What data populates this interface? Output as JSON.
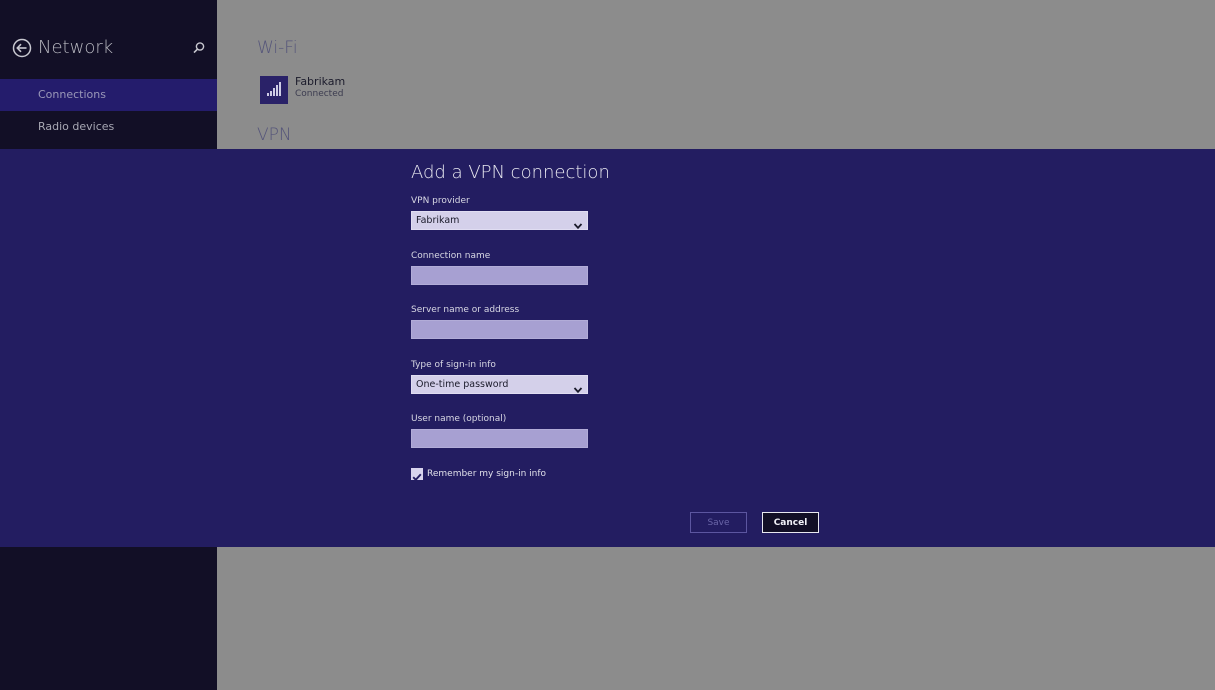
{
  "sidebar": {
    "title": "Network",
    "items": [
      {
        "label": "Connections",
        "active": true
      },
      {
        "label": "Radio devices",
        "active": false
      }
    ]
  },
  "main": {
    "wifi_heading": "Wi-Fi",
    "network": {
      "name": "Fabrikam",
      "status": "Connected"
    },
    "vpn_heading": "VPN"
  },
  "dialog": {
    "title": "Add a VPN connection",
    "fields": {
      "vpn_provider": {
        "label": "VPN provider",
        "value": "Fabrikam"
      },
      "connection_name": {
        "label": "Connection name",
        "value": ""
      },
      "server": {
        "label": "Server name or address",
        "value": ""
      },
      "signin_type": {
        "label": "Type of sign-in info",
        "value": "One-time password"
      },
      "username": {
        "label": "User name (optional)",
        "value": ""
      }
    },
    "remember": {
      "label": "Remember my sign-in info",
      "checked": true
    },
    "save_label": "Save",
    "cancel_label": "Cancel"
  },
  "colors": {
    "sidebar_bg": "#120f26",
    "accent": "#231d61",
    "backdrop": "#8c8c8c"
  }
}
